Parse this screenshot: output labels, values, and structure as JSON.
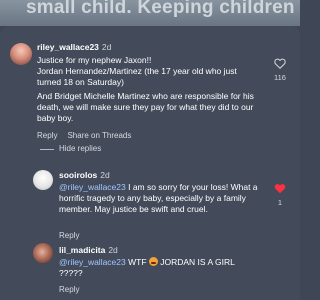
{
  "banner": {
    "text": "small child. Keeping children safe"
  },
  "comments": [
    {
      "username": "riley_wallace23",
      "age": "2d",
      "lines": [
        "Justice for my nephew Jaxon!!",
        "Jordan Hernandez/Martinez (the 17 year old who just turned 18 on Saturday)",
        "And Bridget Michelle Martinez who are responsible for his death, we will make sure they pay for what they did to our baby boy."
      ],
      "actions": {
        "reply": "Reply",
        "share": "Share on Threads"
      },
      "likes": "116"
    },
    {
      "username": "sooirolos",
      "age": "2d",
      "mention": "@riley_wallace23",
      "text": " I am so sorry for your loss! What a horrific tragedy to any baby, especially by a family member. May justice be swift and cruel.",
      "actions": {
        "reply": "Reply"
      },
      "likes": "1"
    },
    {
      "username": "lil_madicita",
      "age": "2d",
      "mention": "@riley_wallace23",
      "text_before_emoji": " WTF ",
      "text_after_emoji": " JORDAN IS A GIRL ?????",
      "actions": {
        "reply": "Reply"
      }
    }
  ],
  "hide_replies": "Hide replies",
  "colors": {
    "background": "#434b5b",
    "mention": "#a3c6ff",
    "liked_heart": "#ff3040"
  }
}
